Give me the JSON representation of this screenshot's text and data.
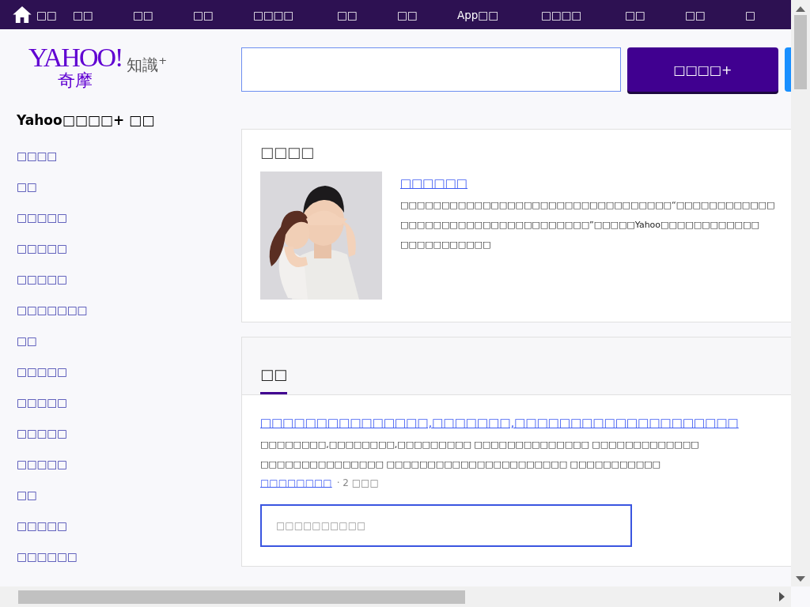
{
  "nav": {
    "items": [
      {
        "kind": "home",
        "label": "□□"
      },
      {
        "kind": "link",
        "label": "□□"
      },
      {
        "kind": "link",
        "label": "□□"
      },
      {
        "kind": "link",
        "label": "□□"
      },
      {
        "kind": "link",
        "label": "□□□□"
      },
      {
        "kind": "link",
        "label": "□□"
      },
      {
        "kind": "link",
        "label": "□□"
      },
      {
        "kind": "link",
        "label": "App□□"
      },
      {
        "kind": "link",
        "label": "□□□□"
      },
      {
        "kind": "link",
        "label": "□□"
      },
      {
        "kind": "link",
        "label": "□□"
      },
      {
        "kind": "link",
        "label": "□"
      }
    ]
  },
  "logo": {
    "brand": "YAHOO!",
    "region": "奇摩",
    "product": "知識",
    "mark": "+"
  },
  "search": {
    "button": "□□□□+"
  },
  "sidebar": {
    "title": "Yahoo□□□□+ □□",
    "items": [
      "□□□□",
      "□□",
      "□□□□□",
      "□□□□□",
      "□□□□□",
      "□□□□□□□",
      "□□",
      "□□□□□",
      "□□□□□",
      "□□□□□",
      "□□□□□",
      "□□",
      "□□□□□",
      "□□□□□□"
    ]
  },
  "featured": {
    "heading": "□□□□",
    "title": "□□□□□□",
    "lines": [
      "□□□□□□□□□□□□□□□□□□□□□□□□□□□□□□□□□“□□□□□□□□□□□□",
      "□□□□□□□□□□□□□□□□□□□□□□□”□□□□□Yahoo□□□□□□□□□□□□",
      "□□□□□□□□□□□"
    ]
  },
  "questions": {
    "tabs": [
      {
        "label": "□□",
        "selected": true
      }
    ],
    "items": [
      {
        "title": "□□□□□□□□□□□□□□□,□□□□□□□,□□□□□□□□□□□□□□□□□□□□",
        "lines": [
          "□□□□□□□□,□□□□□□□□,□□□□□□□□□ □□□□□□□□□□□□□□ □□□□□□□□□□□□□",
          "□□□□□□□□□□□□□□□ □□□□□□□□□□□□□□□□□□□□□□ □□□□□□□□□□□"
        ],
        "category": "□□□□□□□□",
        "meta": "· 2 □□□",
        "answer_placeholder": "□□□□□□□□□□"
      }
    ]
  }
}
